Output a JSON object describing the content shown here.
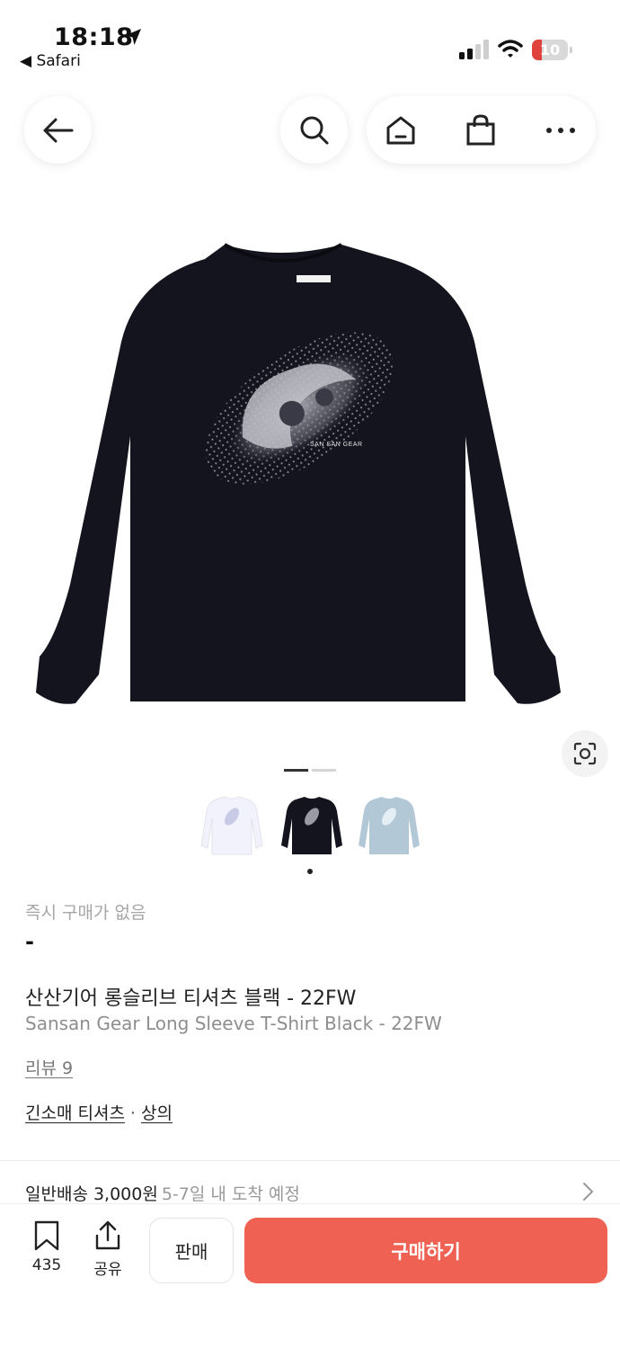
{
  "status_bar": {
    "time": "18:18",
    "back_app": "◀ Safari",
    "battery_level": "10",
    "battery_color": "#e0433b"
  },
  "nav": {
    "back_icon": "arrow-left-icon",
    "search_icon": "search-icon",
    "home_icon": "home-icon",
    "cart_icon": "shopping-bag-icon",
    "more_icon": "more-horizontal-icon"
  },
  "gallery": {
    "image": "black long sleeve t-shirt with graphic print",
    "print_text": "SAN SAN GEAR",
    "page_indicator": {
      "current": 1,
      "total": 2
    },
    "color_options": [
      {
        "color": "white",
        "hex": "#f1f2fb"
      },
      {
        "color": "black",
        "hex": "#14141f"
      },
      {
        "color": "light blue",
        "hex": "#b3c8d7"
      }
    ],
    "selected_option": 1
  },
  "product": {
    "instant_purchase_label": "즉시 구매가 없음",
    "price": "-",
    "name_ko": "산산기어 롱슬리브 티셔츠 블랙 - 22FW",
    "name_en": "Sansan Gear Long Sleeve T-Shirt Black - 22FW",
    "review": "리뷰 9",
    "category": "긴소매 티셔츠",
    "category_sep": "·",
    "subcategory": "상의"
  },
  "shipping": {
    "label": "일반배송 3,000원",
    "eta": "5-7일 내 도착 예정"
  },
  "bottom_bar": {
    "bookmark_count": "435",
    "share_label": "공유",
    "sell_label": "판매",
    "buy_label": "구매하기",
    "accent": "#ef6253"
  }
}
